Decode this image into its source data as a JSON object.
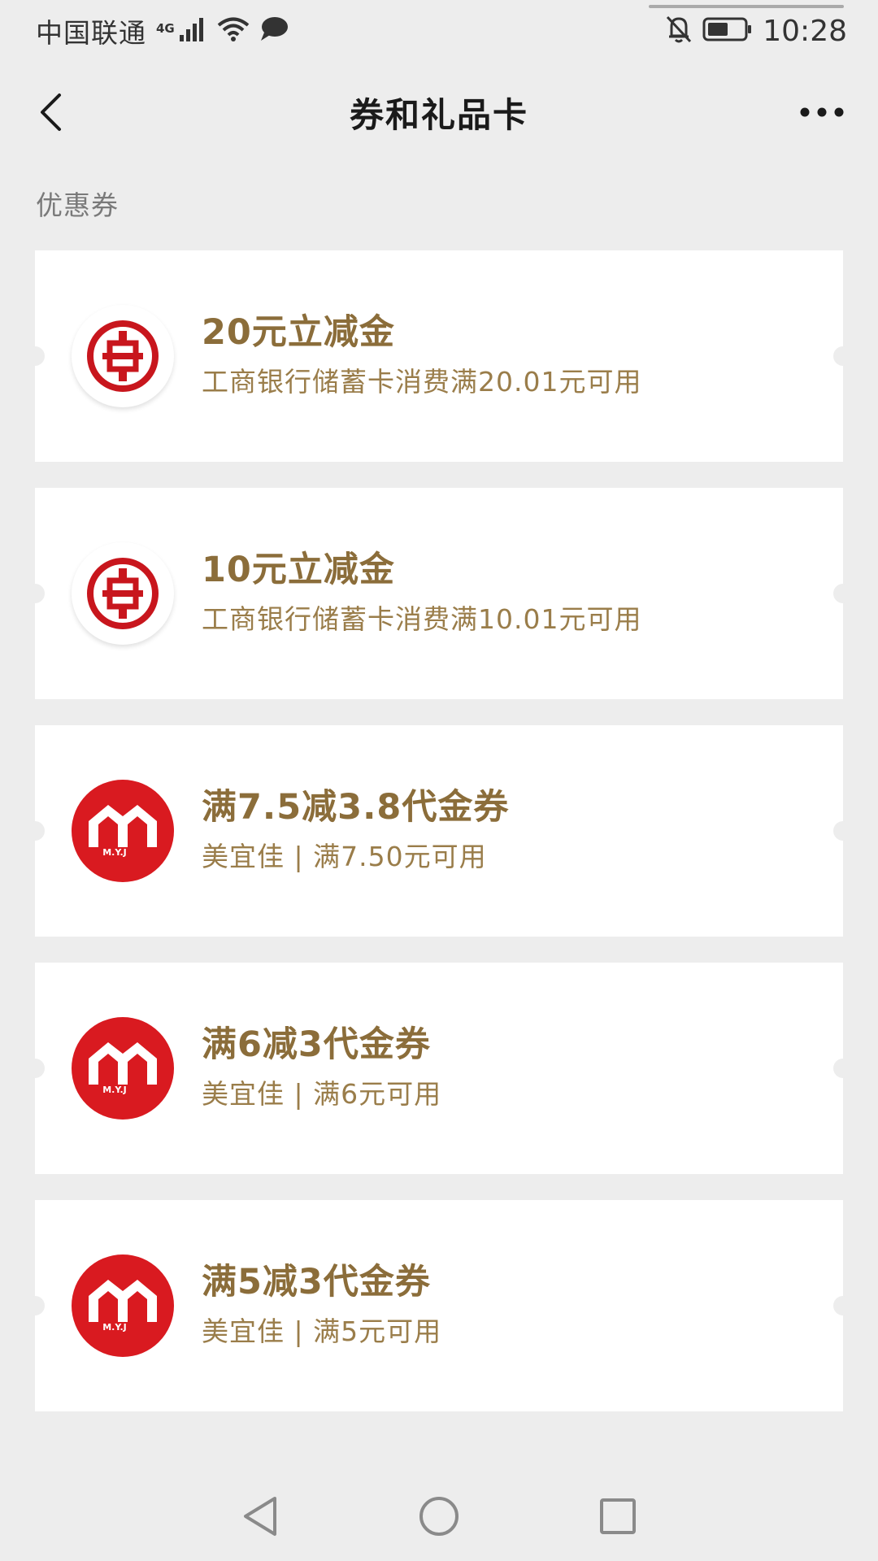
{
  "status_bar": {
    "carrier": "中国联通",
    "network": "4G",
    "time": "10:28"
  },
  "nav": {
    "title": "券和礼品卡"
  },
  "section": {
    "label": "优惠券"
  },
  "coupons": [
    {
      "logo": "icbc-logo",
      "title": "20元立减金",
      "desc": "工商银行储蓄卡消费满20.01元可用"
    },
    {
      "logo": "icbc-logo",
      "title": "10元立减金",
      "desc": "工商银行储蓄卡消费满10.01元可用"
    },
    {
      "logo": "myj-logo",
      "logo_text": "M.Y.J",
      "title": "满7.5减3.8代金券",
      "desc": "美宜佳 | 满7.50元可用"
    },
    {
      "logo": "myj-logo",
      "logo_text": "M.Y.J",
      "title": "满6减3代金券",
      "desc": "美宜佳 | 满6元可用"
    },
    {
      "logo": "myj-logo",
      "logo_text": "M.Y.J",
      "title": "满5减3代金券",
      "desc": "美宜佳 | 满5元可用"
    }
  ],
  "colors": {
    "background": "#ededed",
    "card": "#ffffff",
    "coupon_title": "#8b6d3a",
    "coupon_desc": "#9a7d4a",
    "icbc_red": "#c8161d",
    "myj_red": "#d91a20"
  },
  "icons": {
    "back": "chevron-left-icon",
    "more": "more-dots-icon",
    "nav_back": "triangle-back-icon",
    "nav_home": "circle-home-icon",
    "nav_recent": "square-recent-icon"
  }
}
